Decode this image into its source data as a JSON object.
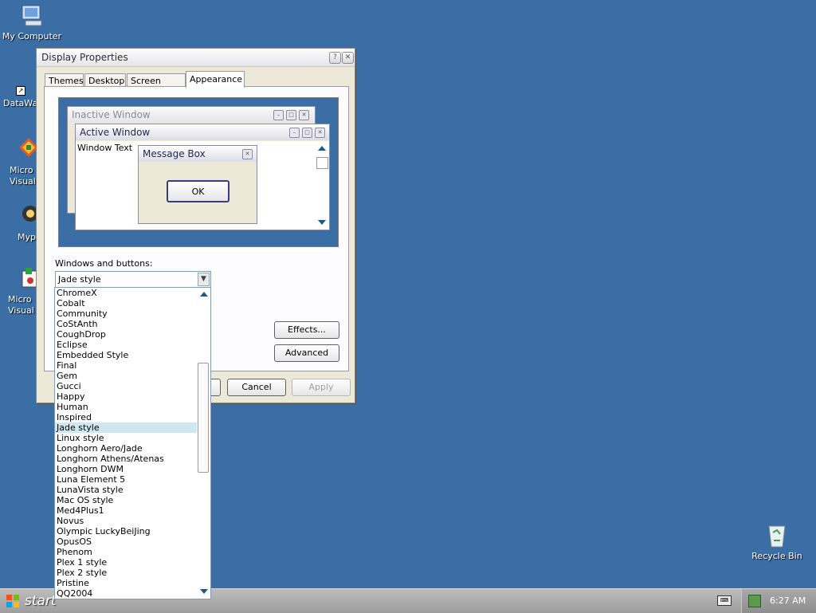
{
  "desktop": {
    "icons": [
      {
        "label": "My Computer"
      },
      {
        "label": "DataWa"
      },
      {
        "label": "Micro\nVisual"
      },
      {
        "label": "Myp"
      },
      {
        "label": "Micro\nVisual"
      },
      {
        "label": "Recycle Bin"
      }
    ]
  },
  "window": {
    "title": "Display Properties",
    "tabs": [
      "Themes",
      "Desktop",
      "Screen Saver",
      "Appearance"
    ],
    "preview": {
      "inactive_title": "Inactive Window",
      "active_title": "Active Window",
      "window_text": "Window Text",
      "message_title": "Message Box",
      "ok_label": "OK"
    },
    "windows_buttons_label": "Windows and buttons:",
    "selected_style": "Jade style",
    "effects_label": "Effects...",
    "advanced_label": "Advanced",
    "cancel_label": "Cancel",
    "apply_label": "Apply"
  },
  "dropdown": {
    "items": [
      "ChromeX",
      "Cobalt",
      "Community",
      "CoStAnth",
      "CoughDrop",
      "Eclipse",
      "Embedded Style",
      "Final",
      "Gem",
      "Gucci",
      "Happy",
      "Human",
      "Inspired",
      "Jade style",
      "Linux style",
      "Longhorn Aero/Jade",
      "Longhorn Athens/Atenas",
      "Longhorn DWM",
      "Luna Element 5",
      "LunaVista style",
      "Mac OS style",
      "Med4Plus1",
      "Novus",
      "Olympic LuckyBeiJing",
      "OpusOS",
      "Phenom",
      "Plex 1 style",
      "Plex 2 style",
      "Pristine",
      "QQ2004"
    ],
    "selected_index": 13
  },
  "taskbar": {
    "start_label": "start",
    "clock": "6:27 AM"
  },
  "colors": {
    "desktop": "#3a6ea5",
    "window_face": "#ece9d8",
    "selection": "#cfe8ef"
  }
}
